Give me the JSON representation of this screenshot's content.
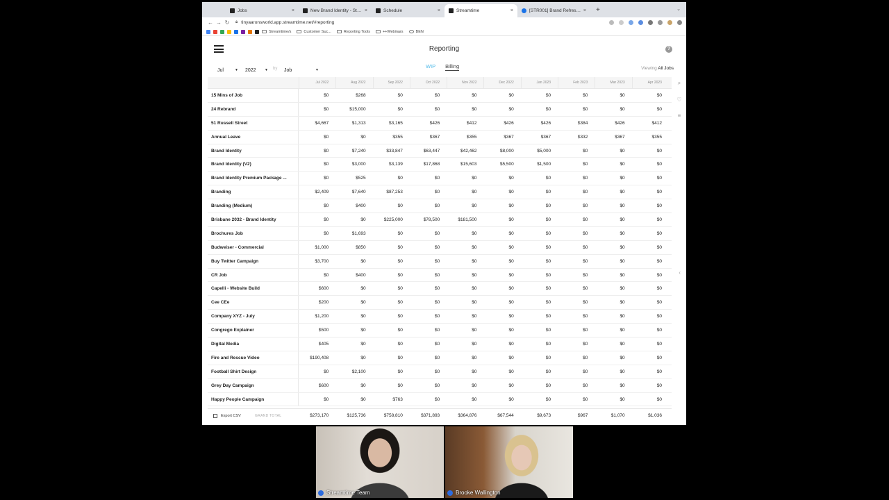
{
  "browser": {
    "tabs": [
      {
        "title": "Jobs",
        "active": false
      },
      {
        "title": "New Brand Identity - Streamtime",
        "active": false
      },
      {
        "title": "Schedule",
        "active": false
      },
      {
        "title": "Streamtime",
        "active": true
      },
      {
        "title": "[STR001] Brand Refresh - summary",
        "active": false
      }
    ],
    "url": "tinyaaronsworld.app.streamtime.net/#reporting",
    "bookmarks": [
      "Streamtime/s",
      "Customer Suc...",
      "Reporting Tools",
      "++Webinars",
      "BEN"
    ]
  },
  "app": {
    "title": "Reporting",
    "help": "?",
    "filters": {
      "month": "Jul",
      "year": "2022",
      "by": "by",
      "group": "Job",
      "mode_wip": "WIP",
      "mode_billing": "Billing",
      "viewing_label": "Viewing",
      "viewing_value": "All Jobs"
    }
  },
  "table": {
    "months": [
      "Jul 2022",
      "Aug 2022",
      "Sep 2022",
      "Oct 2022",
      "Nov 2022",
      "Dec 2022",
      "Jan 2023",
      "Feb 2023",
      "Mar 2023",
      "Apr 2023"
    ],
    "rows": [
      {
        "name": "15 Mins of Job",
        "values": [
          "$0",
          "$268",
          "$0",
          "$0",
          "$0",
          "$0",
          "$0",
          "$0",
          "$0",
          "$0"
        ]
      },
      {
        "name": "24 Rebrand",
        "values": [
          "$0",
          "$15,000",
          "$0",
          "$0",
          "$0",
          "$0",
          "$0",
          "$0",
          "$0",
          "$0"
        ]
      },
      {
        "name": "51 Russell Street",
        "values": [
          "$4,667",
          "$1,313",
          "$3,165",
          "$426",
          "$412",
          "$426",
          "$426",
          "$384",
          "$426",
          "$412"
        ]
      },
      {
        "name": "Annual Leave",
        "values": [
          "$0",
          "$0",
          "$355",
          "$367",
          "$355",
          "$367",
          "$367",
          "$332",
          "$367",
          "$355"
        ]
      },
      {
        "name": "Brand Identity",
        "values": [
          "$0",
          "$7,240",
          "$33,847",
          "$63,447",
          "$42,462",
          "$8,000",
          "$5,000",
          "$0",
          "$0",
          "$0"
        ]
      },
      {
        "name": "Brand Identity (V2)",
        "values": [
          "$0",
          "$3,000",
          "$3,139",
          "$17,868",
          "$15,603",
          "$5,500",
          "$1,500",
          "$0",
          "$0",
          "$0"
        ]
      },
      {
        "name": "Brand Identity Premium Package ...",
        "values": [
          "$0",
          "$525",
          "$0",
          "$0",
          "$0",
          "$0",
          "$0",
          "$0",
          "$0",
          "$0"
        ]
      },
      {
        "name": "Branding",
        "values": [
          "$2,409",
          "$7,640",
          "$87,253",
          "$0",
          "$0",
          "$0",
          "$0",
          "$0",
          "$0",
          "$0"
        ]
      },
      {
        "name": "Branding (Medium)",
        "values": [
          "$0",
          "$400",
          "$0",
          "$0",
          "$0",
          "$0",
          "$0",
          "$0",
          "$0",
          "$0"
        ]
      },
      {
        "name": "Brisbane 2032 - Brand Identity",
        "values": [
          "$0",
          "$0",
          "$225,000",
          "$78,500",
          "$181,500",
          "$0",
          "$0",
          "$0",
          "$0",
          "$0"
        ]
      },
      {
        "name": "Brochures Job",
        "values": [
          "$0",
          "$1,693",
          "$0",
          "$0",
          "$0",
          "$0",
          "$0",
          "$0",
          "$0",
          "$0"
        ]
      },
      {
        "name": "Budweiser - Commercial",
        "values": [
          "$1,000",
          "$850",
          "$0",
          "$0",
          "$0",
          "$0",
          "$0",
          "$0",
          "$0",
          "$0"
        ]
      },
      {
        "name": "Buy Twitter Campaign",
        "values": [
          "$3,700",
          "$0",
          "$0",
          "$0",
          "$0",
          "$0",
          "$0",
          "$0",
          "$0",
          "$0"
        ]
      },
      {
        "name": "CR Job",
        "values": [
          "$0",
          "$400",
          "$0",
          "$0",
          "$0",
          "$0",
          "$0",
          "$0",
          "$0",
          "$0"
        ]
      },
      {
        "name": "Capelli - Website Build",
        "values": [
          "$600",
          "$0",
          "$0",
          "$0",
          "$0",
          "$0",
          "$0",
          "$0",
          "$0",
          "$0"
        ]
      },
      {
        "name": "Cee CEe",
        "values": [
          "$200",
          "$0",
          "$0",
          "$0",
          "$0",
          "$0",
          "$0",
          "$0",
          "$0",
          "$0"
        ]
      },
      {
        "name": "Company XYZ - July",
        "values": [
          "$1,200",
          "$0",
          "$0",
          "$0",
          "$0",
          "$0",
          "$0",
          "$0",
          "$0",
          "$0"
        ]
      },
      {
        "name": "Congrego Explainer",
        "values": [
          "$500",
          "$0",
          "$0",
          "$0",
          "$0",
          "$0",
          "$0",
          "$0",
          "$0",
          "$0"
        ]
      },
      {
        "name": "Digital Media",
        "values": [
          "$405",
          "$0",
          "$0",
          "$0",
          "$0",
          "$0",
          "$0",
          "$0",
          "$0",
          "$0"
        ]
      },
      {
        "name": "Fire and Rescue Video",
        "values": [
          "$190,408",
          "$0",
          "$0",
          "$0",
          "$0",
          "$0",
          "$0",
          "$0",
          "$0",
          "$0"
        ]
      },
      {
        "name": "Football Shirt Design",
        "values": [
          "$0",
          "$2,100",
          "$0",
          "$0",
          "$0",
          "$0",
          "$0",
          "$0",
          "$0",
          "$0"
        ]
      },
      {
        "name": "Grey Day Campaign",
        "values": [
          "$600",
          "$0",
          "$0",
          "$0",
          "$0",
          "$0",
          "$0",
          "$0",
          "$0",
          "$0"
        ]
      },
      {
        "name": "Happy People Campaign",
        "values": [
          "$0",
          "$0",
          "$763",
          "$0",
          "$0",
          "$0",
          "$0",
          "$0",
          "$0",
          "$0"
        ]
      }
    ],
    "export_label": "Export CSV",
    "grand_total_label": "GRAND TOTAL",
    "totals": [
      "$273,170",
      "$125,736",
      "$758,810",
      "$371,893",
      "$364,876",
      "$67,544",
      "$9,673",
      "$967",
      "$1,070",
      "$1,036"
    ]
  },
  "video": {
    "participants": [
      "Streamtime Team",
      "Brooke Wallington"
    ]
  }
}
